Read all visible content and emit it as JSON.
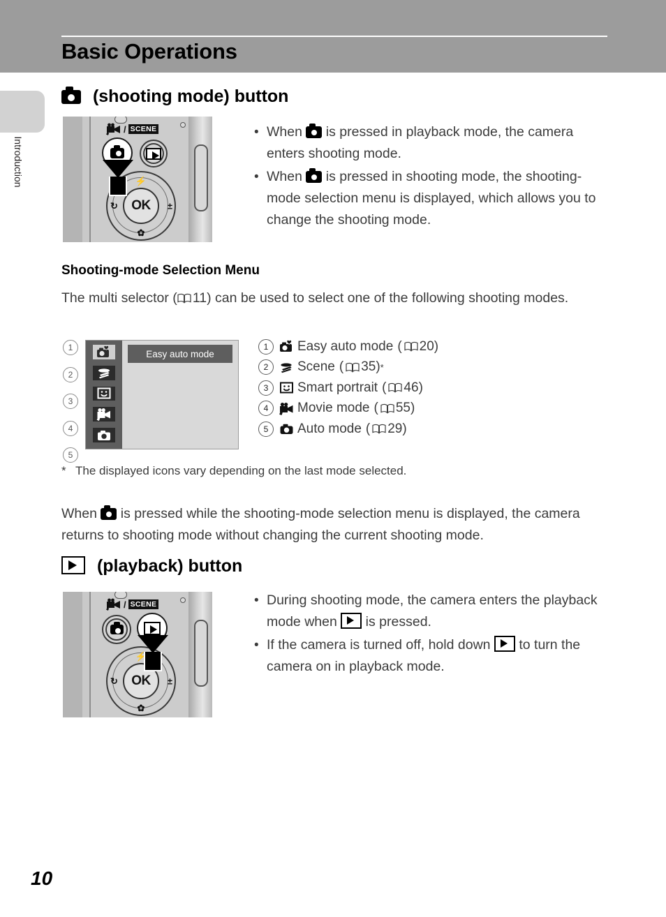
{
  "header": {
    "title": "Basic Operations"
  },
  "sidebar": {
    "label": "Introduction"
  },
  "page": {
    "number": "10"
  },
  "section1": {
    "heading_suffix": "(shooting mode) button",
    "heading_icon": "camera-icon",
    "bullets": [
      {
        "pre": "When",
        "icon": "camera-icon",
        "post": "is pressed in playback mode, the camera enters shooting mode."
      },
      {
        "pre": "When",
        "icon": "camera-icon",
        "post": "is pressed in shooting mode, the shooting-mode selection menu is displayed, which allows you to change the shooting mode."
      }
    ]
  },
  "subsection": {
    "heading": "Shooting-mode Selection Menu",
    "intro_pre": "The multi selector (",
    "intro_page": "11",
    "intro_post": ") can be used to select one of the following shooting modes.",
    "menu_screen": {
      "selected_label": "Easy auto mode",
      "rail_icons": [
        "easy-auto-icon",
        "scene-icon",
        "smart-portrait-icon",
        "movie-icon",
        "auto-camera-icon"
      ],
      "callout_numbers": [
        "1",
        "2",
        "3",
        "4",
        "5"
      ]
    },
    "legend": [
      {
        "num": "1",
        "icon": "easy-auto-icon",
        "label": "Easy auto mode",
        "page": "20",
        "star": ""
      },
      {
        "num": "2",
        "icon": "scene-icon",
        "label": "Scene",
        "page": "35",
        "star": "*"
      },
      {
        "num": "3",
        "icon": "smart-portrait-icon",
        "label": "Smart portrait",
        "page": "46",
        "star": ""
      },
      {
        "num": "4",
        "icon": "movie-icon",
        "label": "Movie mode",
        "page": "55",
        "star": ""
      },
      {
        "num": "5",
        "icon": "auto-camera-icon",
        "label": "Auto mode",
        "page": "29",
        "star": ""
      }
    ],
    "footnote_marker": "*",
    "footnote": "The displayed icons vary depending on the last mode selected.",
    "closing_pre": "When",
    "closing_post": "is pressed while the shooting-mode selection menu is displayed, the camera returns to shooting mode without changing the current shooting mode."
  },
  "section2": {
    "heading_suffix": "(playback) button",
    "heading_icon": "playback-icon",
    "bullets": [
      {
        "pre": "During shooting mode, the camera enters the playback mode when",
        "icon": "playback-icon",
        "post": "is pressed."
      },
      {
        "pre": "If the camera is turned off, hold down",
        "icon": "playback-icon",
        "post": "to turn the camera on in playback mode."
      }
    ]
  },
  "camera_diagram": {
    "mode_label_icon": "movie-icon",
    "mode_label_slash": "/",
    "mode_label_scene": "SCENE",
    "ok_label": "OK",
    "dial_marks": {
      "top": "flash-icon",
      "right": "exposure-compensation-icon",
      "bottom": "macro-icon",
      "left": "self-timer-icon"
    },
    "diagram1_highlight": "shooting-mode-button",
    "diagram2_highlight": "playback-button"
  },
  "colors": {
    "header_band": "#9c9c9c",
    "side_tab": "#d2d2d2",
    "menu_screen_bg": "#d9d9d9",
    "menu_rail": "#5e5e5e",
    "menu_highlight": "#5e5e5e",
    "body_text": "#3b3b3b"
  }
}
